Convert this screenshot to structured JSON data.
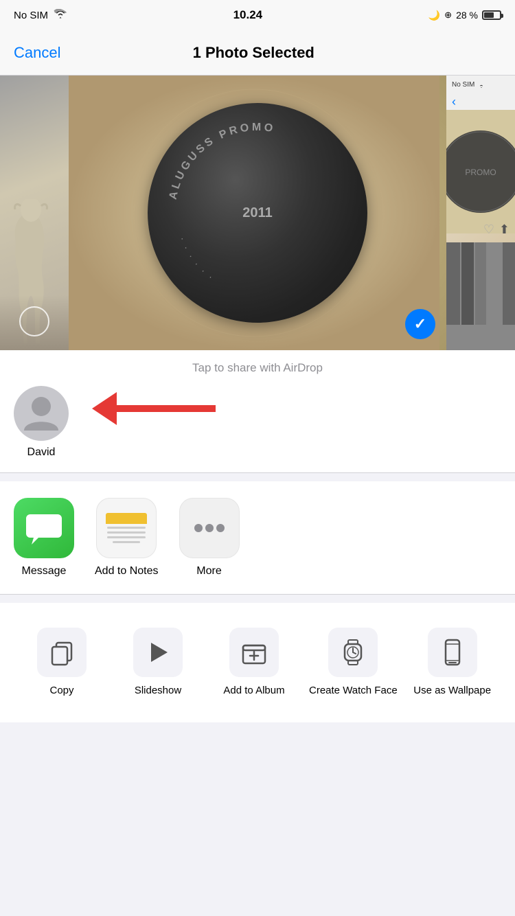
{
  "statusBar": {
    "carrier": "No SIM",
    "time": "10.24",
    "battery": "28 %",
    "doNotDisturb": true
  },
  "navBar": {
    "cancelLabel": "Cancel",
    "title": "1 Photo Selected"
  },
  "photos": {
    "airdropHint": "Tap to share with AirDrop",
    "selectedCount": 1
  },
  "contacts": [
    {
      "name": "David"
    }
  ],
  "shareApps": [
    {
      "id": "message",
      "label": "Message"
    },
    {
      "id": "notes",
      "label": "Add to Notes"
    },
    {
      "id": "more",
      "label": "More"
    }
  ],
  "actions": [
    {
      "id": "copy",
      "label": "Copy",
      "icon": "copy"
    },
    {
      "id": "slideshow",
      "label": "Slideshow",
      "icon": "play"
    },
    {
      "id": "add-to-album",
      "label": "Add to Album",
      "icon": "album"
    },
    {
      "id": "create-watch-face",
      "label": "Create Watch Face",
      "icon": "watch"
    },
    {
      "id": "use-as-wallpaper",
      "label": "Use as Wallpape",
      "icon": "phone"
    }
  ]
}
